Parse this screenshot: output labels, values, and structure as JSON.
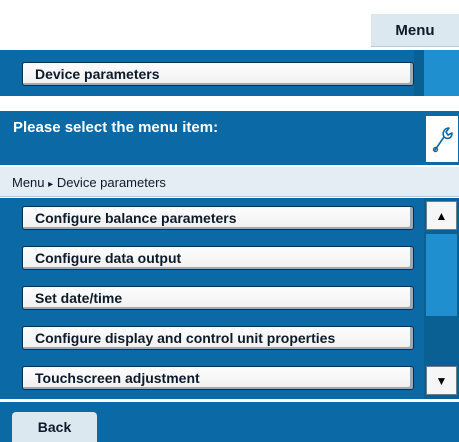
{
  "top_fragment": {
    "menu_button_label": "Menu",
    "device_parameters_label": "Device parameters"
  },
  "header": {
    "title": "Please select the menu item:",
    "icon": "wrench-icon"
  },
  "breadcrumb": {
    "root": "Menu",
    "separator": "▸",
    "current": "Device parameters"
  },
  "menu_items": [
    {
      "label": "Configure balance parameters"
    },
    {
      "label": "Configure data output"
    },
    {
      "label": "Set date/time"
    },
    {
      "label": "Configure display and control unit properties"
    },
    {
      "label": "Touchscreen adjustment"
    }
  ],
  "scrollbar": {
    "up_icon": "triangle-up-icon",
    "down_icon": "triangle-down-icon"
  },
  "footer": {
    "back_label": "Back"
  },
  "colors": {
    "panel_blue": "#0b6aa5",
    "scroll_thumb": "#1f8fd0",
    "light_bar": "#dce8f0"
  }
}
